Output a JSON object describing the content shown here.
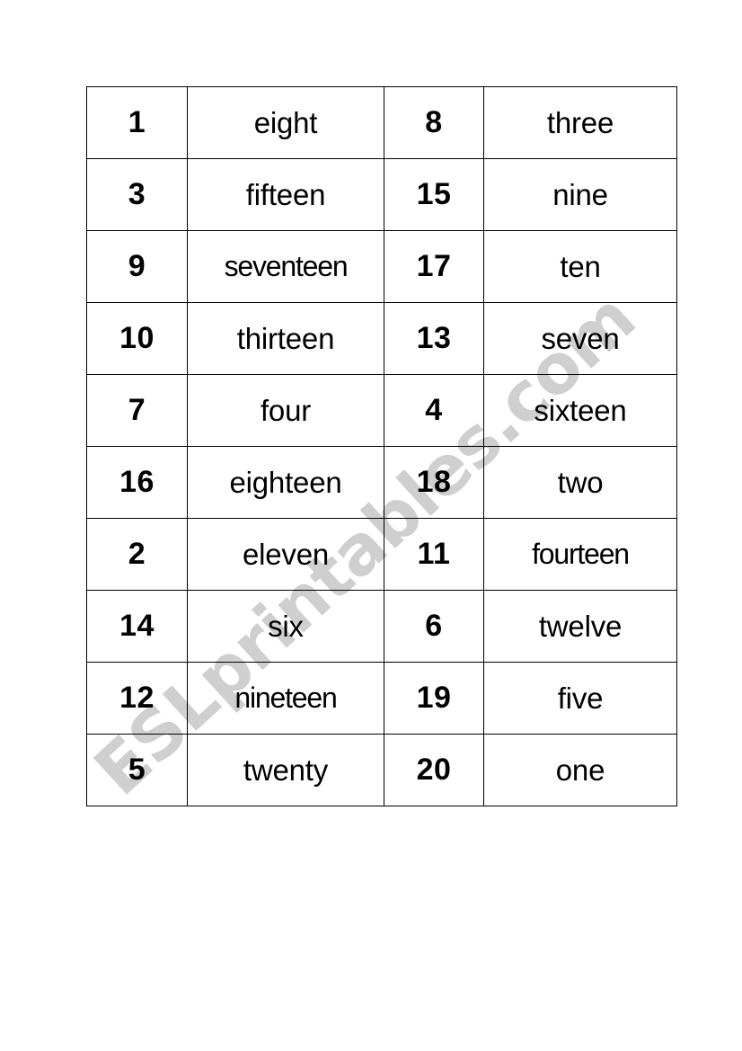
{
  "document": {
    "type": "number-word-matching-cards-worksheet",
    "watermark": "ESLprintables.com",
    "watermark_color": "#cfcfcf",
    "page_background": "#ffffff",
    "border_color": "#000000"
  },
  "table": {
    "columns": 4,
    "rows": 10,
    "column_kinds": [
      "number",
      "word",
      "number",
      "word"
    ],
    "data": [
      {
        "num_a": "1",
        "word_a": "eight",
        "num_b": "8",
        "word_b": "three"
      },
      {
        "num_a": "3",
        "word_a": "fifteen",
        "num_b": "15",
        "word_b": "nine"
      },
      {
        "num_a": "9",
        "word_a": "seventeen",
        "num_b": "17",
        "word_b": "ten"
      },
      {
        "num_a": "10",
        "word_a": "thirteen",
        "num_b": "13",
        "word_b": "seven"
      },
      {
        "num_a": "7",
        "word_a": "four",
        "num_b": "4",
        "word_b": "sixteen"
      },
      {
        "num_a": "16",
        "word_a": "eighteen",
        "num_b": "18",
        "word_b": "two"
      },
      {
        "num_a": "2",
        "word_a": "eleven",
        "num_b": "11",
        "word_b": "fourteen"
      },
      {
        "num_a": "14",
        "word_a": "six",
        "num_b": "6",
        "word_b": "twelve"
      },
      {
        "num_a": "12",
        "word_a": "nineteen",
        "num_b": "19",
        "word_b": "five"
      },
      {
        "num_a": "5",
        "word_a": "twenty",
        "num_b": "20",
        "word_b": "one"
      }
    ]
  }
}
